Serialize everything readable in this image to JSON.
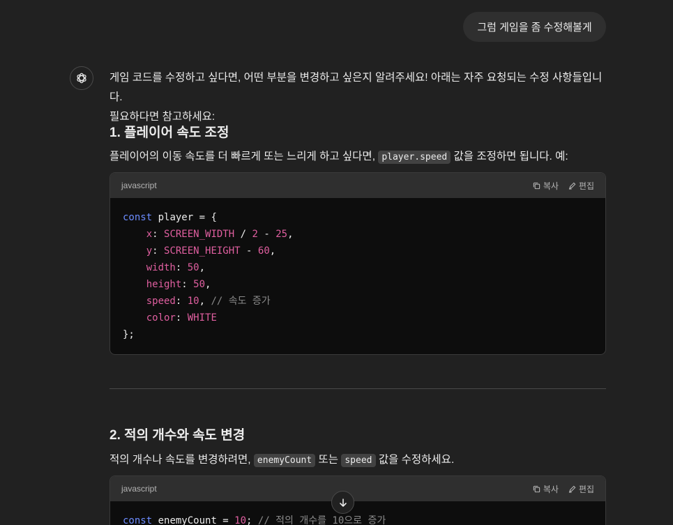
{
  "user_message": "그럼 게임을 좀 수정해볼게",
  "intro": {
    "line1": "게임 코드를 수정하고 싶다면, 어떤 부분을 변경하고 싶은지 알려주세요! 아래는 자주 요청되는 수정 사항들입니다.",
    "line2": "필요하다면 참고하세요:"
  },
  "section1": {
    "title": "1. 플레이어 속도 조정",
    "desc_before": "플레이어의 이동 속도를 더 빠르게 또는 느리게 하고 싶다면,",
    "code_inline": "player.speed",
    "desc_after": "값을 조정하면 됩니다. 예:",
    "block": {
      "lang": "javascript",
      "copy_label": "복사",
      "edit_label": "편집",
      "l1_kw": "const",
      "l1_rest": " player = {",
      "l2_prop": "x",
      "l2_a": ": ",
      "l2_c": "SCREEN_WIDTH",
      "l2_b": " / ",
      "l2_n1": "2",
      "l2_op": " - ",
      "l2_n2": "25",
      "l2_end": ",",
      "l3_prop": "y",
      "l3_a": ": ",
      "l3_c": "SCREEN_HEIGHT",
      "l3_op": " - ",
      "l3_n": "60",
      "l3_end": ",",
      "l4_prop": "width",
      "l4_a": ": ",
      "l4_n": "50",
      "l4_end": ",",
      "l5_prop": "height",
      "l5_a": ": ",
      "l5_n": "50",
      "l5_end": ",",
      "l6_prop": "speed",
      "l6_a": ": ",
      "l6_n": "10",
      "l6_end": ", ",
      "l6_cmt": "// 속도 증가",
      "l7_prop": "color",
      "l7_a": ": ",
      "l7_c": "WHITE",
      "l8": "};"
    }
  },
  "section2": {
    "title": "2. 적의 개수와 속도 변경",
    "desc_before": "적의 개수나 속도를 변경하려면,",
    "code_inline1": "enemyCount",
    "desc_mid": "또는",
    "code_inline2": "speed",
    "desc_after": "값을 수정하세요.",
    "block": {
      "lang": "javascript",
      "copy_label": "복사",
      "edit_label": "편집",
      "l1_kw": "const",
      "l1_rest": " enemyCount = ",
      "l1_n": "10",
      "l1_end": "; ",
      "l1_cmt": "// 적의 개수를 10으로 증가"
    }
  },
  "icons": {
    "avatar": "openai-logo-icon",
    "copy": "copy-icon",
    "edit": "pencil-icon",
    "scroll": "arrow-down-icon"
  },
  "colors": {
    "background": "#212121",
    "bubble": "#2f2f2f",
    "keyword": "#6c8cff",
    "property": "#e05fa0",
    "comment": "#8a8a8a"
  }
}
